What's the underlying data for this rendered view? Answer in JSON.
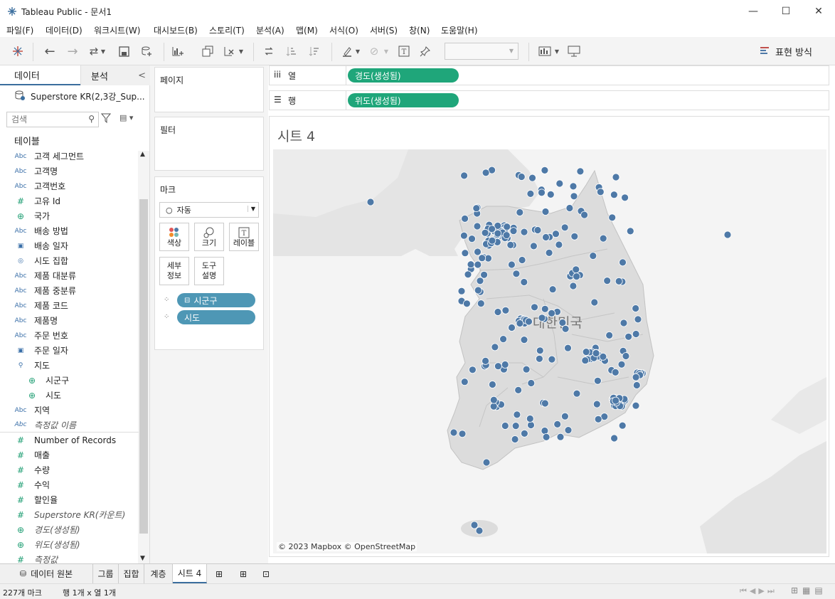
{
  "window": {
    "title": "Tableau Public - 문서1",
    "minimize": "—",
    "maximize": "☐",
    "close": "✕"
  },
  "menu": [
    "파일(F)",
    "데이터(D)",
    "워크시트(W)",
    "대시보드(B)",
    "스토리(T)",
    "분석(A)",
    "맵(M)",
    "서식(O)",
    "서버(S)",
    "창(N)",
    "도움말(H)"
  ],
  "toolbar": {
    "show_me": "표현 방식"
  },
  "left_panel": {
    "tab_data": "데이터",
    "tab_analysis": "분석",
    "collapse": "<",
    "datasource": "Superstore KR(2,3강_Sup...",
    "search_placeholder": "검색",
    "tables_label": "테이블",
    "fields": [
      {
        "icon": "Abc",
        "name": "고객 세그먼트"
      },
      {
        "icon": "Abc",
        "name": "고객명"
      },
      {
        "icon": "Abc",
        "name": "고객번호"
      },
      {
        "icon": "#",
        "name": "고유 Id"
      },
      {
        "icon": "globe",
        "name": "국가"
      },
      {
        "icon": "Abc",
        "name": "배송 방법"
      },
      {
        "icon": "calendar",
        "name": "배송 일자"
      },
      {
        "icon": "set",
        "name": "시도 집합"
      },
      {
        "icon": "Abc",
        "name": "제품 대분류"
      },
      {
        "icon": "Abc",
        "name": "제품 중분류"
      },
      {
        "icon": "Abc",
        "name": "제품 코드"
      },
      {
        "icon": "Abc",
        "name": "제품명"
      },
      {
        "icon": "Abc",
        "name": "주문 번호"
      },
      {
        "icon": "calendar",
        "name": "주문 일자"
      },
      {
        "icon": "hierarchy",
        "name": "지도"
      },
      {
        "icon": "globe",
        "name": "시군구",
        "indent": true
      },
      {
        "icon": "globe",
        "name": "시도",
        "indent": true
      },
      {
        "icon": "Abc",
        "name": "지역"
      },
      {
        "icon": "Abc",
        "name": "측정값 이름",
        "italic": true
      },
      {
        "icon": "#",
        "name": "Number of Records"
      },
      {
        "icon": "#",
        "name": "매출"
      },
      {
        "icon": "#",
        "name": "수량"
      },
      {
        "icon": "#",
        "name": "수익"
      },
      {
        "icon": "#",
        "name": "할인율"
      },
      {
        "icon": "#",
        "name": "Superstore KR(카운트)",
        "italic": true
      },
      {
        "icon": "globe",
        "name": "경도(생성됨)",
        "italic": true
      },
      {
        "icon": "globe",
        "name": "위도(생성됨)",
        "italic": true
      },
      {
        "icon": "#",
        "name": "측정값",
        "italic": true
      }
    ]
  },
  "cards": {
    "pages": "페이지",
    "filters": "필터",
    "marks": "마크",
    "mark_type": "자동",
    "mark_buttons": [
      "색상",
      "크기",
      "레이블",
      "세부 정보",
      "도구 설명"
    ],
    "mark_pills": [
      "시군구",
      "시도"
    ]
  },
  "shelves": {
    "columns_label": "열",
    "columns_pill": "경도(생성됨)",
    "rows_label": "행",
    "rows_pill": "위도(생성됨)"
  },
  "viz": {
    "sheet_title": "시트 4",
    "country_label": "대한민국",
    "attribution": "© 2023 Mapbox © OpenStreetMap",
    "mark_color": "#4e79a7"
  },
  "bottom_tabs": {
    "data_source": "데이터 원본",
    "group": "그룹",
    "set": "집합",
    "hierarchy": "계층",
    "sheet": "시트 4"
  },
  "status": {
    "marks": "227개 마크",
    "rows_cols": "행 1개 x 열 1개"
  }
}
